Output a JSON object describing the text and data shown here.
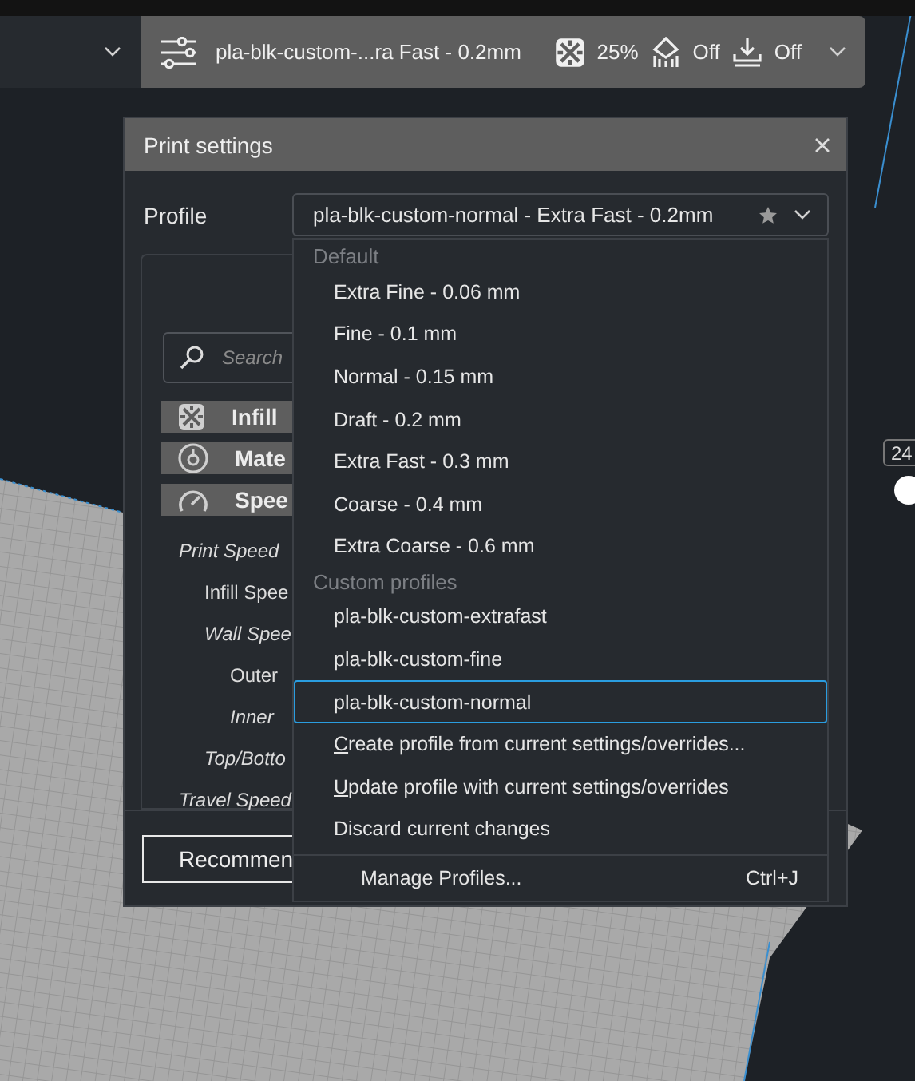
{
  "print_summary": {
    "profile": "pla-blk-custom-...ra Fast - 0.2mm",
    "infill": "25%",
    "support": "Off",
    "adhesion": "Off"
  },
  "layer_slider": {
    "value": "24"
  },
  "dialog": {
    "title": "Print settings",
    "profile_label": "Profile",
    "profile_value": "pla-blk-custom-normal - Extra Fast - 0.2mm",
    "search_placeholder": "Search",
    "categories": [
      {
        "label": "Infill",
        "kind": "infill"
      },
      {
        "label": "Mate",
        "kind": "material"
      },
      {
        "label": "Spee",
        "kind": "speed"
      }
    ],
    "settings": [
      {
        "label": "Print Speed",
        "italic": true,
        "children": [
          {
            "label": "Infill Spee",
            "italic": false
          },
          {
            "label": "Wall Spee",
            "italic": true,
            "children": [
              {
                "label": "Outer",
                "italic": false
              },
              {
                "label": "Inner",
                "italic": true
              }
            ]
          },
          {
            "label": "Top/Botto",
            "italic": true
          }
        ]
      },
      {
        "label": "Travel Speed",
        "italic": true
      }
    ],
    "back_button": "Recommen"
  },
  "profile_menu": {
    "sections": [
      {
        "header": "Default",
        "items": [
          {
            "label": "Extra Fine - 0.06 mm",
            "selected": false
          },
          {
            "label": "Fine - 0.1 mm",
            "selected": false
          },
          {
            "label": "Normal - 0.15 mm",
            "selected": false
          },
          {
            "label": "Draft - 0.2 mm",
            "selected": false
          },
          {
            "label": "Extra Fast - 0.3 mm",
            "selected": false
          },
          {
            "label": "Coarse - 0.4 mm",
            "selected": false
          },
          {
            "label": "Extra Coarse - 0.6 mm",
            "selected": false
          }
        ]
      },
      {
        "header": "Custom profiles",
        "items": [
          {
            "label": "pla-blk-custom-extrafast",
            "selected": false
          },
          {
            "label": "pla-blk-custom-fine",
            "selected": false
          },
          {
            "label": "pla-blk-custom-normal",
            "selected": true
          }
        ]
      }
    ],
    "actions": [
      {
        "label": "Create profile from current settings/overrides...",
        "underline_first": true
      },
      {
        "label": "Update profile with current settings/overrides",
        "underline_first": true
      },
      {
        "label": "Discard current changes",
        "underline_first": false
      }
    ],
    "manage": {
      "label": "Manage Profiles...",
      "shortcut": "Ctrl+J"
    }
  }
}
